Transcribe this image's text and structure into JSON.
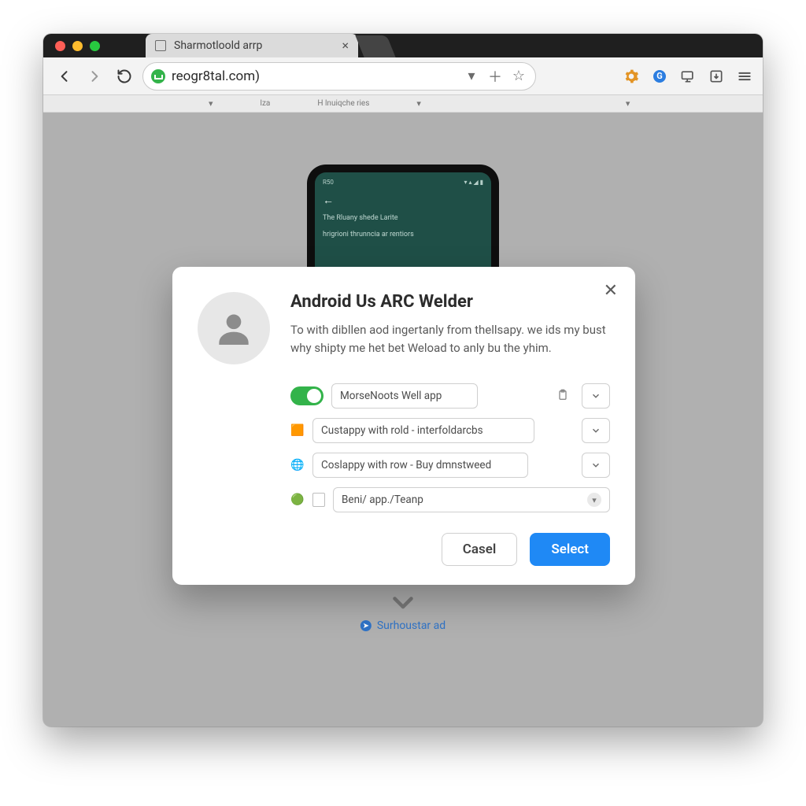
{
  "tab": {
    "title": "Sharmotloold arrp"
  },
  "address": {
    "url": "reogr8tal.com)"
  },
  "ext_badge": "G",
  "subbar": {
    "a": "lza",
    "b": "H lnuiqche ries"
  },
  "phone": {
    "time": "R50",
    "signal": "▾ ▴ ◢ ▮",
    "line1": "The Rluany shede Larite",
    "line2": "hrigrioni thrunncia ar rentiors"
  },
  "modal": {
    "title": "Android Us ARC Welder",
    "desc": "To with dibllen aod ingertanly from thellsapy. we ids my bust why shipty me het bet Weload to anly bu the yhim.",
    "opt1": "MorseNoots Well app",
    "opt2": "Custappy with rold - interfoldarcbs",
    "opt3": "Coslappy with row - Buy dmnstweed",
    "path": "Beni/ app./Teanp",
    "cancel": "Casel",
    "select": "Select"
  },
  "bottom": {
    "label": "Surhoustar ad"
  }
}
